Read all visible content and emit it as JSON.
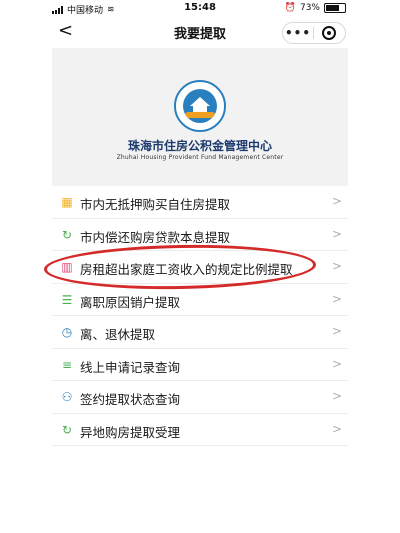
{
  "status": {
    "carrier": "中国移动",
    "time": "15:48",
    "battery": "73%",
    "battery_level": 0.73
  },
  "nav": {
    "back": "<",
    "title": "我要提取",
    "more": "•••"
  },
  "banner": {
    "org_cn": "珠海市住房公积金管理中心",
    "org_en": "Zhuhai Housing Provident Fund Management Center"
  },
  "menu": {
    "items": [
      {
        "label": "市内无抵押购买自住房提取",
        "icon": "buildings-icon",
        "icon_color": "#f0b020"
      },
      {
        "label": "市内偿还购房贷款本息提取",
        "icon": "refresh-icon",
        "icon_color": "#4caf50"
      },
      {
        "label": "房租超出家庭工资收入的规定比例提取",
        "icon": "chart-icon",
        "icon_color": "#e24b7a"
      },
      {
        "label": "离职原因销户提取",
        "icon": "list-icon",
        "icon_color": "#4caf50"
      },
      {
        "label": "离、退休提取",
        "icon": "clock-icon",
        "icon_color": "#2a7fbf"
      },
      {
        "label": "线上申请记录查询",
        "icon": "stack-icon",
        "icon_color": "#4caf50"
      },
      {
        "label": "签约提取状态查询",
        "icon": "user-plus-icon",
        "icon_color": "#2a7fbf"
      },
      {
        "label": "异地购房提取受理",
        "icon": "refresh-icon",
        "icon_color": "#4caf50"
      }
    ],
    "chevron": ">"
  }
}
